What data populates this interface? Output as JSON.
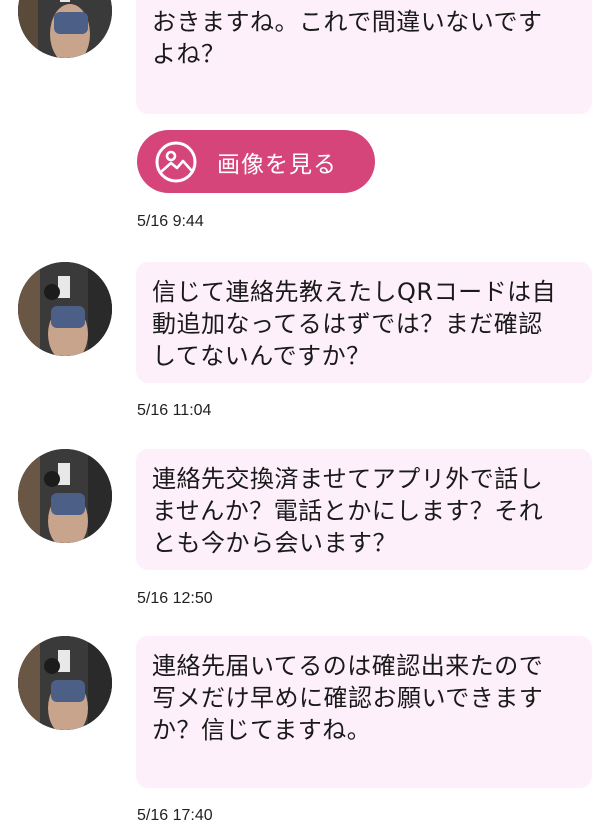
{
  "colors": {
    "bubble_bg": "#fdf0fb",
    "accent": "#d6457a",
    "text": "#1a1a1a"
  },
  "messages": [
    {
      "text": "おきますね。これで間違いないです\nよね？",
      "attachment_label": "画像を見る",
      "attachment_icon": "image-icon",
      "timestamp": "5/16 9:44"
    },
    {
      "text": "信じて連絡先教えたしQRコードは自\n動追加なってるはずでは？まだ確認\nしてないんですか？",
      "timestamp": "5/16 11:04"
    },
    {
      "text": "連絡先交換済ませてアプリ外で話し\nませんか？電話とかにします？それ\nとも今から会います？",
      "timestamp": "5/16 12:50"
    },
    {
      "text": "連絡先届いてるのは確認出来たので\n写メだけ早めに確認お願いできます\nか？信じてますね。",
      "timestamp": "5/16 17:40"
    }
  ]
}
